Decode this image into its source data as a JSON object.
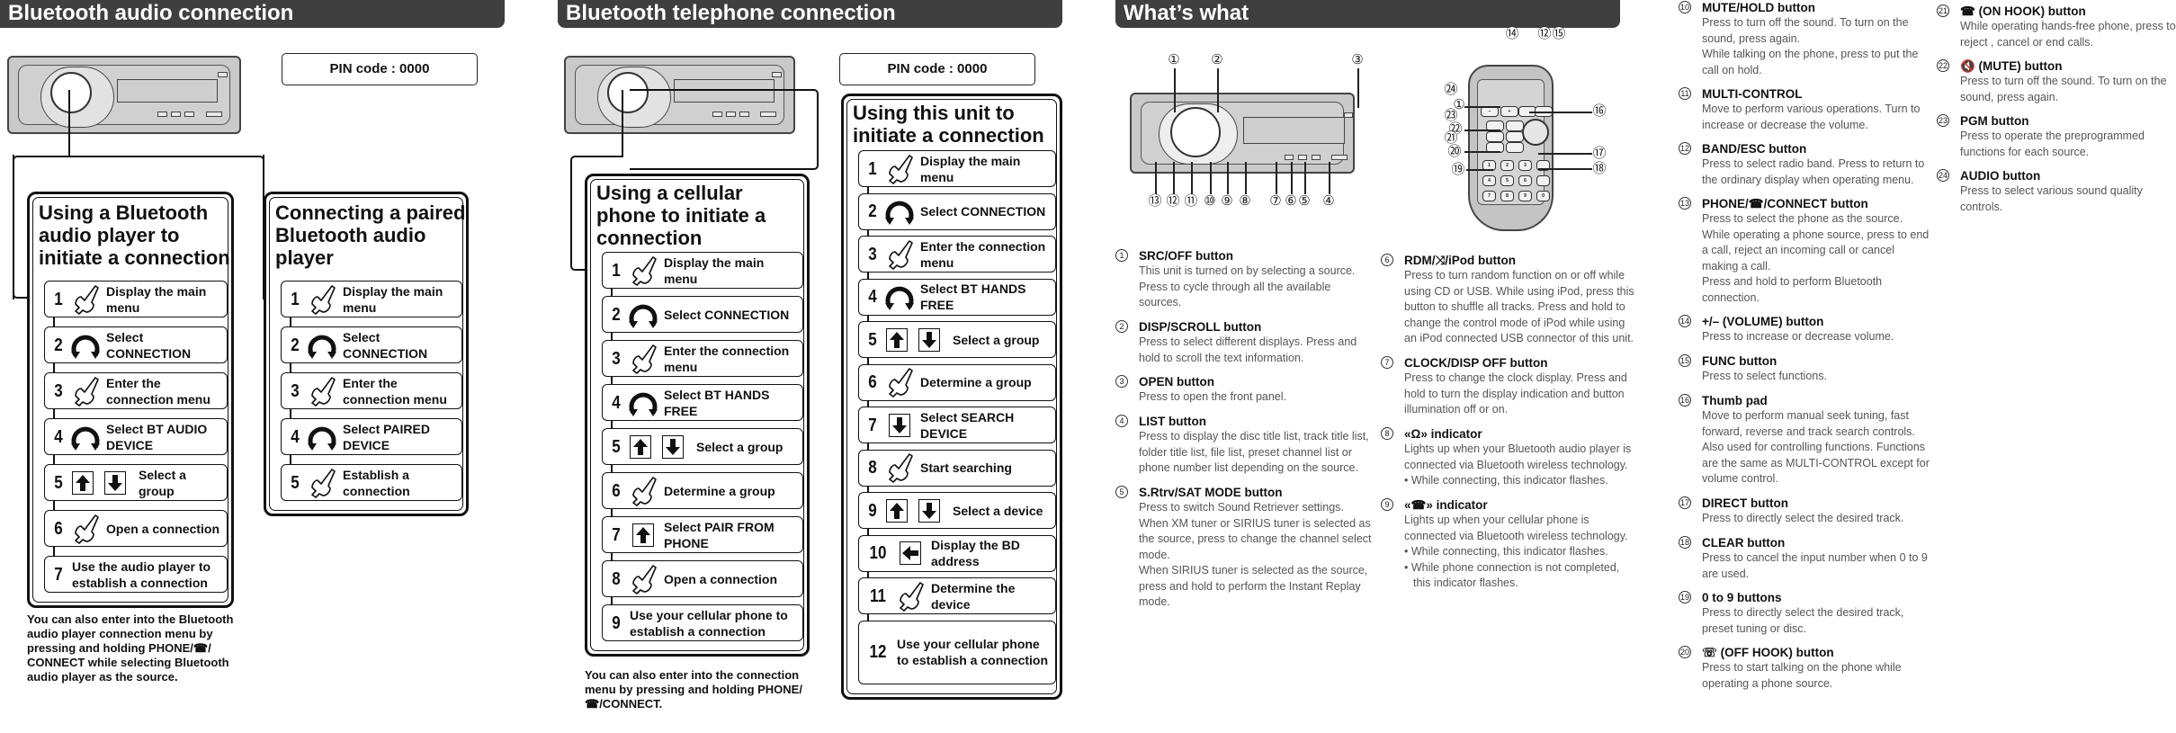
{
  "sections": {
    "audio": {
      "header": "Bluetooth audio connection",
      "pin": "PIN code : 0000",
      "flow_a": {
        "title": [
          "Using a Bluetooth",
          "audio player to",
          "initiate a connection"
        ],
        "steps": [
          {
            "n": "1",
            "icon": "press-hand-icon",
            "text": "Display the main menu"
          },
          {
            "n": "2",
            "icon": "rotate-knob-icon",
            "text": "Select CONNECTION"
          },
          {
            "n": "3",
            "icon": "press-hand-icon",
            "text": "Enter the connection menu"
          },
          {
            "n": "4",
            "icon": "rotate-knob-icon",
            "text": "Select BT AUDIO DEVICE"
          },
          {
            "n": "5",
            "icon": "up-down-keys-icon",
            "text": "Select a group"
          },
          {
            "n": "6",
            "icon": "press-hand-icon",
            "text": "Open a connection"
          },
          {
            "n": "7",
            "icon": "",
            "text": "Use the audio player to establish a connection"
          }
        ]
      },
      "flow_b": {
        "title": [
          "Connecting a paired",
          "Bluetooth audio",
          "player"
        ],
        "steps": [
          {
            "n": "1",
            "icon": "press-hand-icon",
            "text": "Display the main menu"
          },
          {
            "n": "2",
            "icon": "rotate-knob-icon",
            "text": "Select CONNECTION"
          },
          {
            "n": "3",
            "icon": "press-hand-icon",
            "text": "Enter the connection menu"
          },
          {
            "n": "4",
            "icon": "rotate-knob-icon",
            "text": "Select PAIRED DEVICE"
          },
          {
            "n": "5",
            "icon": "press-hand-icon",
            "text": "Establish a connection"
          }
        ]
      },
      "note": "You can also enter into the Bluetooth audio player connection menu by pressing and holding PHONE/☎/ CONNECT while selecting Bluetooth audio player as the source."
    },
    "telephone": {
      "header": "Bluetooth telephone connection",
      "pin": "PIN code : 0000",
      "flow_a": {
        "title": [
          "Using a cellular",
          "phone to initiate a",
          "connection"
        ],
        "steps": [
          {
            "n": "1",
            "icon": "press-hand-icon",
            "text": "Display the main menu"
          },
          {
            "n": "2",
            "icon": "rotate-knob-icon",
            "text": "Select CONNECTION"
          },
          {
            "n": "3",
            "icon": "press-hand-icon",
            "text": "Enter the connection menu"
          },
          {
            "n": "4",
            "icon": "rotate-knob-icon",
            "text": "Select BT HANDS FREE"
          },
          {
            "n": "5",
            "icon": "up-down-keys-icon",
            "text": "Select a group"
          },
          {
            "n": "6",
            "icon": "press-hand-icon",
            "text": "Determine a group"
          },
          {
            "n": "7",
            "icon": "up-key-icon",
            "text": "Select PAIR FROM PHONE"
          },
          {
            "n": "8",
            "icon": "press-hand-icon",
            "text": "Open a connection"
          },
          {
            "n": "9",
            "icon": "",
            "text": "Use your cellular phone to establish a connection"
          }
        ]
      },
      "flow_b": {
        "title": [
          "Using this unit to",
          "initiate a connection"
        ],
        "steps": [
          {
            "n": "1",
            "icon": "press-hand-icon",
            "text": "Display the main menu"
          },
          {
            "n": "2",
            "icon": "rotate-knob-icon",
            "text": "Select CONNECTION"
          },
          {
            "n": "3",
            "icon": "press-hand-icon",
            "text": "Enter the connection menu"
          },
          {
            "n": "4",
            "icon": "rotate-knob-icon",
            "text": "Select BT HANDS FREE"
          },
          {
            "n": "5",
            "icon": "up-down-keys-icon",
            "text": "Select a group"
          },
          {
            "n": "6",
            "icon": "press-hand-icon",
            "text": "Determine a group"
          },
          {
            "n": "7",
            "icon": "down-key-icon",
            "text": "Select SEARCH DEVICE"
          },
          {
            "n": "8",
            "icon": "press-hand-icon",
            "text": "Start searching"
          },
          {
            "n": "9",
            "icon": "up-down-keys-icon",
            "text": "Select a device"
          },
          {
            "n": "10",
            "icon": "left-key-icon",
            "text": "Display the BD address"
          },
          {
            "n": "11",
            "icon": "press-hand-icon",
            "text": "Determine the device"
          },
          {
            "n": "12",
            "icon": "",
            "text": "Use your cellular phone to establish a connection"
          }
        ]
      },
      "note": "You can also enter into the connection menu by pressing and holding PHONE/☎/CONNECT."
    },
    "whats_what": {
      "header": "What’s what",
      "unit_callouts": [
        "①",
        "②",
        "③",
        "④",
        "⑤",
        "⑥",
        "⑦",
        "⑧",
        "⑨",
        "⑩",
        "⑪",
        "⑫",
        "⑬"
      ],
      "remote_callouts": [
        "⑭",
        "⑫",
        "⑮",
        "㉔",
        "①",
        "㉓",
        "㉒",
        "㉑",
        "⑳",
        "⑯",
        "⑰",
        "⑱",
        "⑲"
      ],
      "remote_keys": [
        "1",
        "2",
        "3",
        "4",
        "5",
        "6",
        "7",
        "8",
        "9",
        "0"
      ],
      "items": [
        {
          "badge": "1",
          "title": "SRC/OFF button",
          "desc": [
            "This unit is turned on by selecting a source. Press to cycle through all the available sources."
          ]
        },
        {
          "badge": "2",
          "title": "DISP/SCROLL button",
          "desc": [
            "Press to select different displays. Press and hold to scroll the text information."
          ]
        },
        {
          "badge": "3",
          "title": "OPEN button",
          "desc": [
            "Press to open the front panel."
          ]
        },
        {
          "badge": "4",
          "title": "LIST button",
          "desc": [
            "Press to display the disc title list, track title list, folder title list, file list, preset channel list or phone number list depending on the source."
          ]
        },
        {
          "badge": "5",
          "title": "S.Rtrv/SAT MODE button",
          "desc": [
            "Press to switch Sound Retriever settings. When XM tuner or SIRIUS tuner is selected as the source, press to change the channel select mode.",
            "When SIRIUS tuner is selected as the source, press and hold to perform the Instant Replay mode."
          ]
        },
        {
          "badge": "6",
          "title": "RDM/⤨/iPod button",
          "desc": [
            "Press to turn random function on or off while using CD or USB. While using iPod, press this button to shuffle all tracks. Press and hold to change the control mode of iPod while using an iPod connected USB connector of this unit."
          ]
        },
        {
          "badge": "7",
          "title": "CLOCK/DISP OFF button",
          "desc": [
            "Press to change the clock display. Press and hold to turn the display indication and button illumination off or on."
          ]
        },
        {
          "badge": "8",
          "title": "«Ω» indicator",
          "desc": [
            "Lights up when your Bluetooth audio player is connected via Bluetooth wireless technology."
          ],
          "bullets": [
            "While connecting, this indicator flashes."
          ]
        },
        {
          "badge": "9",
          "title": "«☎» indicator",
          "desc": [
            "Lights up when your cellular phone is connected via Bluetooth wireless technology."
          ],
          "bullets": [
            "While connecting, this indicator flashes.",
            "While phone connection is not completed, this indicator flashes."
          ]
        },
        {
          "badge": "10",
          "title": "MUTE/HOLD button",
          "desc": [
            "Press to turn off the sound. To turn on the sound, press again.",
            "While talking on the phone, press to put the call on hold."
          ]
        },
        {
          "badge": "11",
          "title": "MULTI-CONTROL",
          "desc": [
            "Move to perform various operations. Turn to increase or decrease the volume."
          ]
        },
        {
          "badge": "12",
          "title": "BAND/ESC button",
          "desc": [
            "Press to select radio band.  Press to return to the ordinary display when operating menu."
          ]
        },
        {
          "badge": "13",
          "title": "PHONE/☎/CONNECT button",
          "desc": [
            "Press to select the phone as the source.",
            "While operating a phone source, press to end a call, reject an incoming call or cancel making a call.",
            "Press and hold to perform Bluetooth connection."
          ]
        },
        {
          "badge": "14",
          "title": "+/– (VOLUME) button",
          "desc": [
            "Press to increase or decrease volume."
          ]
        },
        {
          "badge": "15",
          "title": "FUNC button",
          "desc": [
            "Press to select functions."
          ]
        },
        {
          "badge": "16",
          "title": "Thumb pad",
          "desc": [
            "Move to perform manual seek tuning, fast forward, reverse and track search controls. Also used for controlling functions. Functions are the same as MULTI-CONTROL except for volume control."
          ]
        },
        {
          "badge": "17",
          "title": "DIRECT button",
          "desc": [
            "Press to directly select the desired track."
          ]
        },
        {
          "badge": "18",
          "title": "CLEAR button",
          "desc": [
            "Press to cancel the input number when 0 to 9 are used."
          ]
        },
        {
          "badge": "19",
          "title": "0 to 9 buttons",
          "desc": [
            "Press to directly select the desired track, preset tuning or disc."
          ]
        },
        {
          "badge": "20",
          "title": "☏ (OFF HOOK) button",
          "desc": [
            "Press to start talking on the phone while operating a phone source."
          ]
        },
        {
          "badge": "21",
          "title": "☎ (ON HOOK) button",
          "desc": [
            "While operating hands-free phone, press to reject , cancel or end calls."
          ]
        },
        {
          "badge": "22",
          "title": "🔇 (MUTE) button",
          "desc": [
            "Press to turn off the sound. To turn on the sound, press again."
          ]
        },
        {
          "badge": "23",
          "title": "PGM button",
          "desc": [
            "Press to operate the preprogrammed functions for each source."
          ]
        },
        {
          "badge": "24",
          "title": "AUDIO button",
          "desc": [
            "Press to select various sound quality controls."
          ]
        }
      ]
    }
  },
  "colors": {
    "header_bg": "#3f3f3f",
    "header_text": "#ffffff",
    "device_gray": "#c9c9c9",
    "body_text": "#555555"
  }
}
